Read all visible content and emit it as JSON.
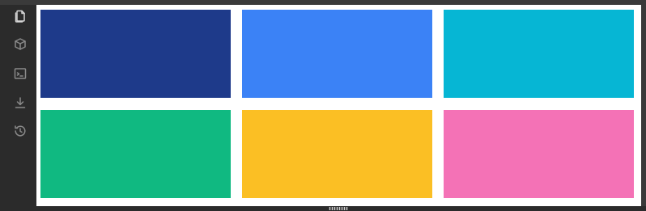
{
  "sidebar": {
    "items": [
      {
        "icon": "files-icon",
        "active": true
      },
      {
        "icon": "package-icon",
        "active": false
      },
      {
        "icon": "terminal-icon",
        "active": false
      },
      {
        "icon": "download-icon",
        "active": false
      },
      {
        "icon": "history-icon",
        "active": false
      }
    ]
  },
  "swatches": [
    {
      "color": "#1e3a8a"
    },
    {
      "color": "#3b82f6"
    },
    {
      "color": "#06b6d4"
    },
    {
      "color": "#10b981"
    },
    {
      "color": "#fbbf24"
    },
    {
      "color": "#f472b6"
    }
  ]
}
